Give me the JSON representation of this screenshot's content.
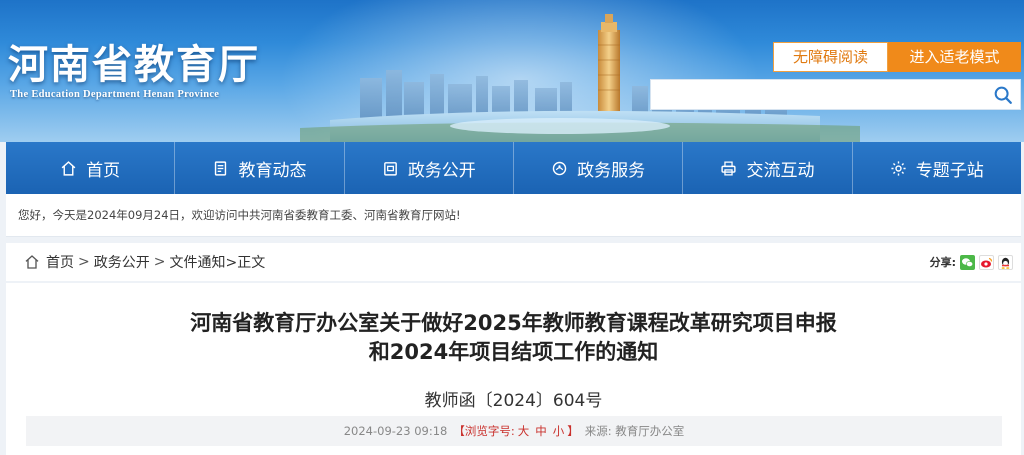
{
  "header": {
    "title": "河南省教育厅",
    "subtitle": "The Education Department Henan Province",
    "accessibility_button": "无障碍阅读",
    "elder_mode_button": "进入适老模式",
    "search": {
      "value": "",
      "placeholder": ""
    },
    "search_icon": "search-icon"
  },
  "nav": {
    "items": [
      {
        "label": "首页",
        "icon": "home-icon"
      },
      {
        "label": "教育动态",
        "icon": "document-icon"
      },
      {
        "label": "政务公开",
        "icon": "clipboard-icon"
      },
      {
        "label": "政务服务",
        "icon": "service-icon"
      },
      {
        "label": "交流互动",
        "icon": "printer-icon"
      },
      {
        "label": "专题子站",
        "icon": "settings-icon"
      }
    ]
  },
  "welcome": "您好，今天是2024年09月24日，欢迎访问中共河南省委教育工委、河南省教育厅网站!",
  "breadcrumb": {
    "home": "首页",
    "sep1": ">",
    "level1": "政务公开",
    "sep2": ">",
    "level2": "文件通知",
    "current": ">正文"
  },
  "share": {
    "label": "分享:",
    "icons": [
      "wechat-icon",
      "weibo-icon",
      "qq-icon"
    ]
  },
  "article": {
    "title_line1": "河南省教育厅办公室关于做好2025年教师教育课程改革研究项目申报",
    "title_line2": "和2024年项目结项工作的通知",
    "doc_number": "教师函〔2024〕604号",
    "date": "2024-09-23 09:18",
    "font_label": "【浏览字号:",
    "size_large": "大",
    "size_medium": "中",
    "size_small": "小",
    "font_close": "】",
    "source": "来源: 教育厅办公室"
  },
  "colors": {
    "nav_bg": "#1b63b3",
    "elder_button": "#f08a1a",
    "accessibility_text": "#e07a10",
    "highlight_red": "#c9302c"
  }
}
